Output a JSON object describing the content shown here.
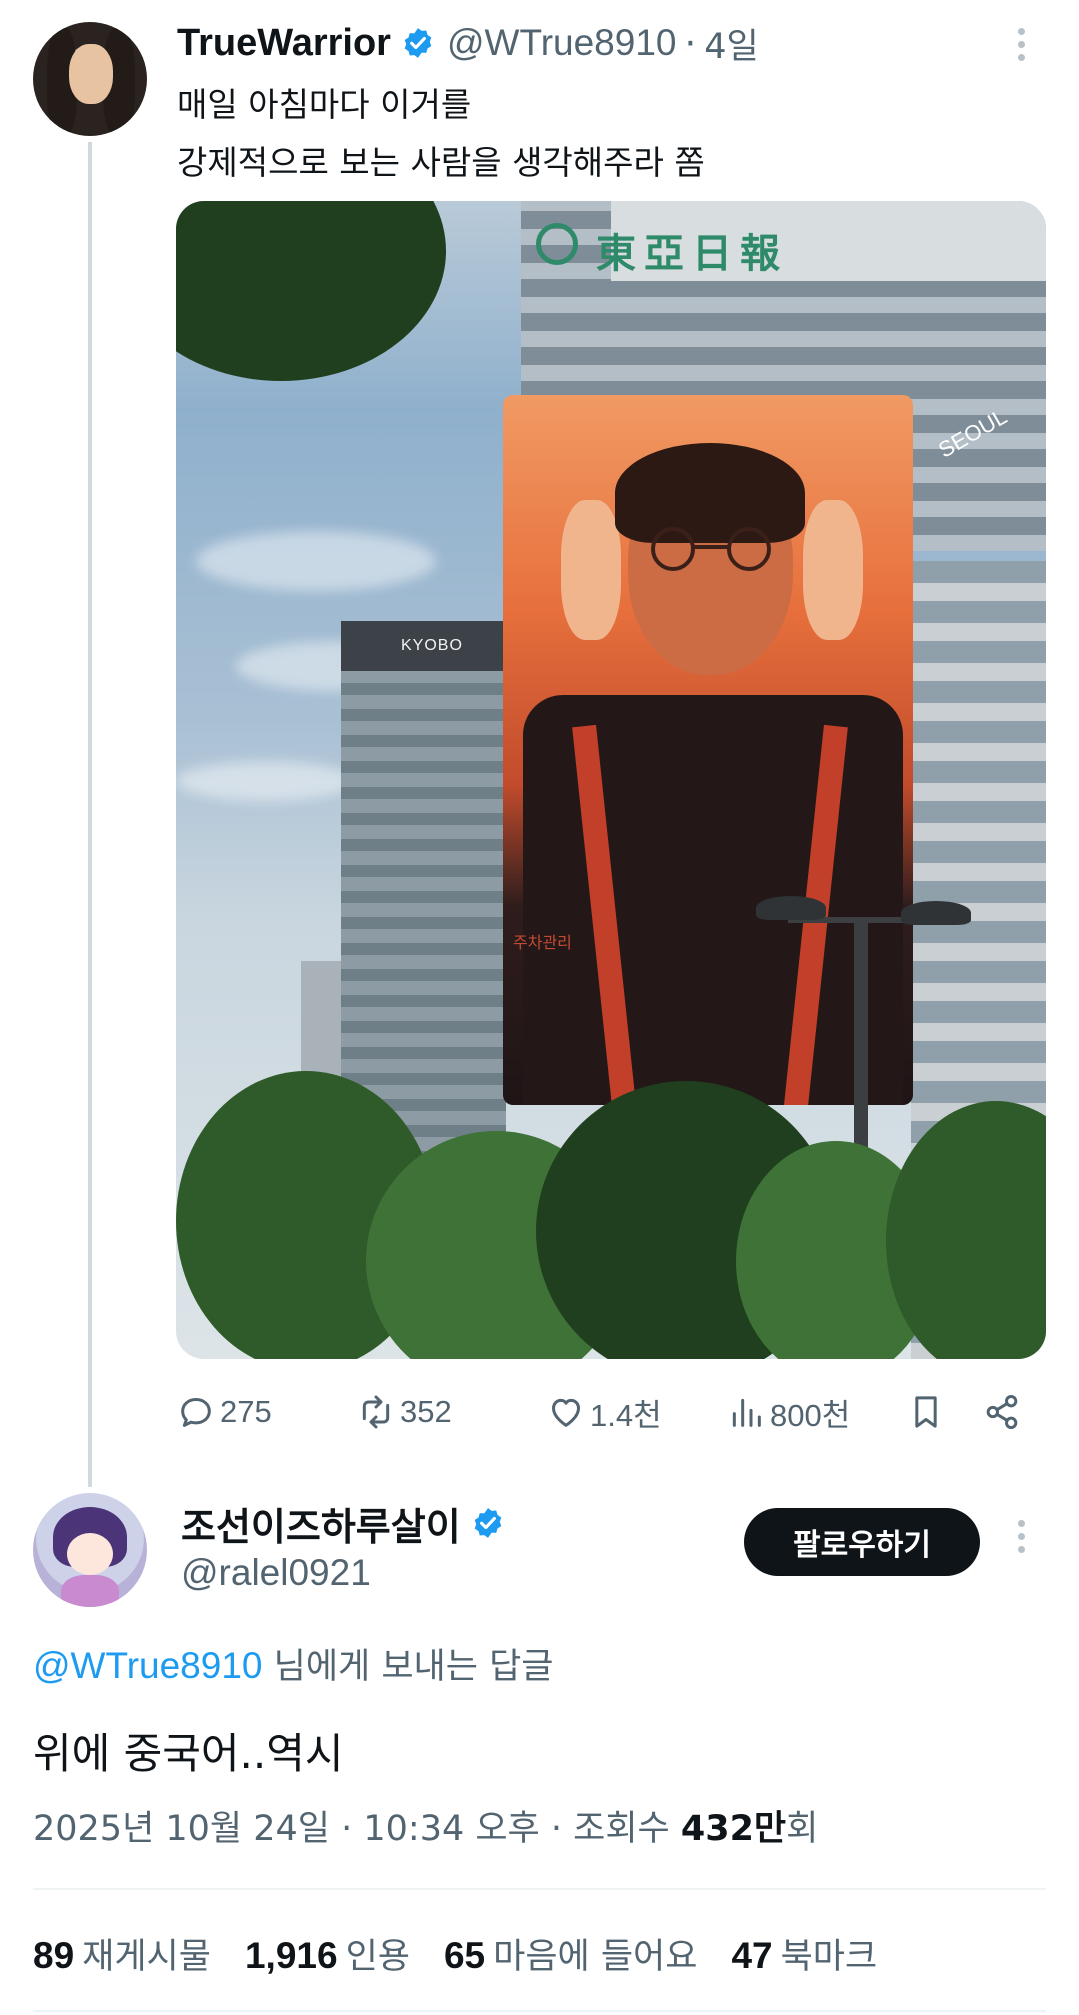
{
  "colors": {
    "text": "#0f1419",
    "secondary": "#536471",
    "accent": "#1d9bf0",
    "verified_badge": "#1d9bf0",
    "thread_line": "#cfd9de",
    "follow_button": "#0f1419"
  },
  "original_tweet": {
    "display_name": "TrueWarrior",
    "handle": "@WTrue8910",
    "separator": "·",
    "time": "4일",
    "text_line1": "매일 아침마다 이거를",
    "text_line2": "강제적으로 보는 사람을 생각해주라 쫌",
    "media": {
      "building_sign": "東亞日報",
      "kyobo_sign": "KYOBO",
      "seoul_sign": "SEOUL",
      "billboard_caption": "주차관리"
    },
    "actions": {
      "replies": "275",
      "retweets": "352",
      "likes": "1.4천",
      "views": "800천"
    },
    "icons": [
      "verified-icon",
      "more-icon",
      "reply-icon",
      "retweet-icon",
      "like-icon",
      "views-icon",
      "bookmark-icon",
      "share-icon"
    ]
  },
  "reply_tweet": {
    "display_name": "조선이즈하루살이",
    "handle": "@ralel0921",
    "follow_label": "팔로우하기",
    "replying_to_mention": "@WTrue8910",
    "replying_to_suffix": " 님에게 보내는 답글",
    "text": "위에 중국어..역시",
    "meta_prefix": "2025년 10월 24일 · 10:34 오후 · 조회수 ",
    "meta_views_bold": "432만",
    "meta_suffix": "회",
    "stats": {
      "reposts_count": "89",
      "reposts_label": "재게시물",
      "quotes_count": "1,916",
      "quotes_label": "인용",
      "likes_count": "65",
      "likes_label": "마음에 들어요",
      "bookmarks_count": "47",
      "bookmarks_label": "북마크"
    }
  }
}
